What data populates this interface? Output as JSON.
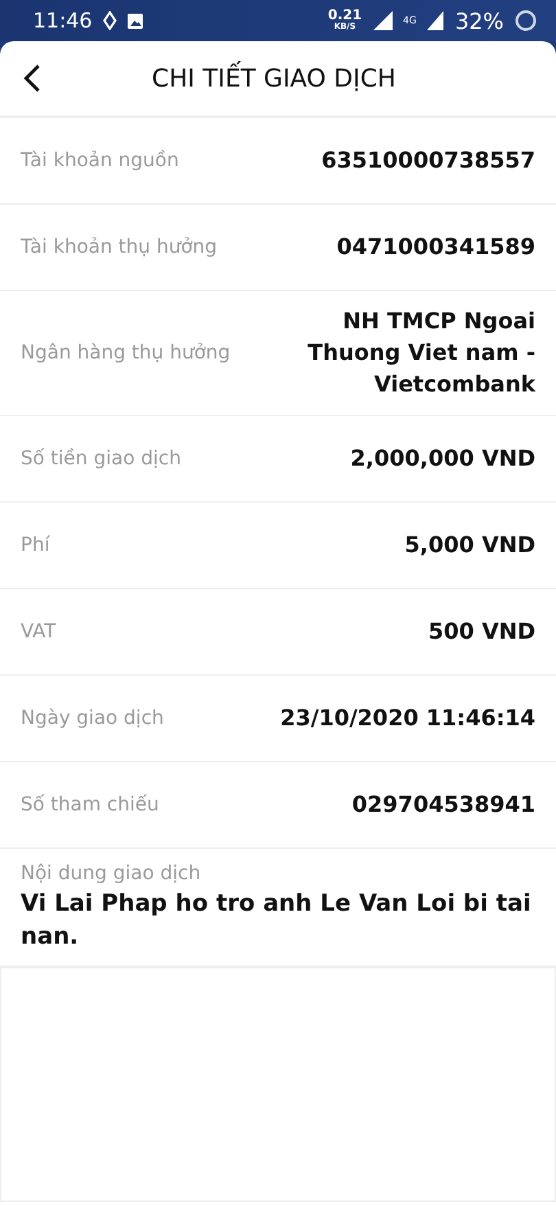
{
  "status_bar": {
    "time": "11:46",
    "net_speed": "0.21",
    "net_unit": "KB/S",
    "network": "4G",
    "battery": "32%"
  },
  "header": {
    "title": "CHI TIẾT GIAO DỊCH"
  },
  "details": [
    {
      "label": "Tài khoản nguồn",
      "value": "63510000738557"
    },
    {
      "label": "Tài khoản thụ hưởng",
      "value": "0471000341589"
    },
    {
      "label": "Ngân hàng thụ hưởng",
      "value": "NH TMCP Ngoai Thuong Viet nam - Vietcombank"
    },
    {
      "label": "Số tiền giao dịch",
      "value": "2,000,000 VND"
    },
    {
      "label": "Phí",
      "value": "5,000 VND"
    },
    {
      "label": "VAT",
      "value": "500 VND"
    },
    {
      "label": "Ngày giao dịch",
      "value": "23/10/2020 11:46:14"
    },
    {
      "label": "Số tham chiếu",
      "value": "029704538941"
    }
  ],
  "content": {
    "label": "Nội dung giao dịch",
    "value": "Vi Lai Phap ho tro anh Le Van Loi bi tai nan."
  }
}
